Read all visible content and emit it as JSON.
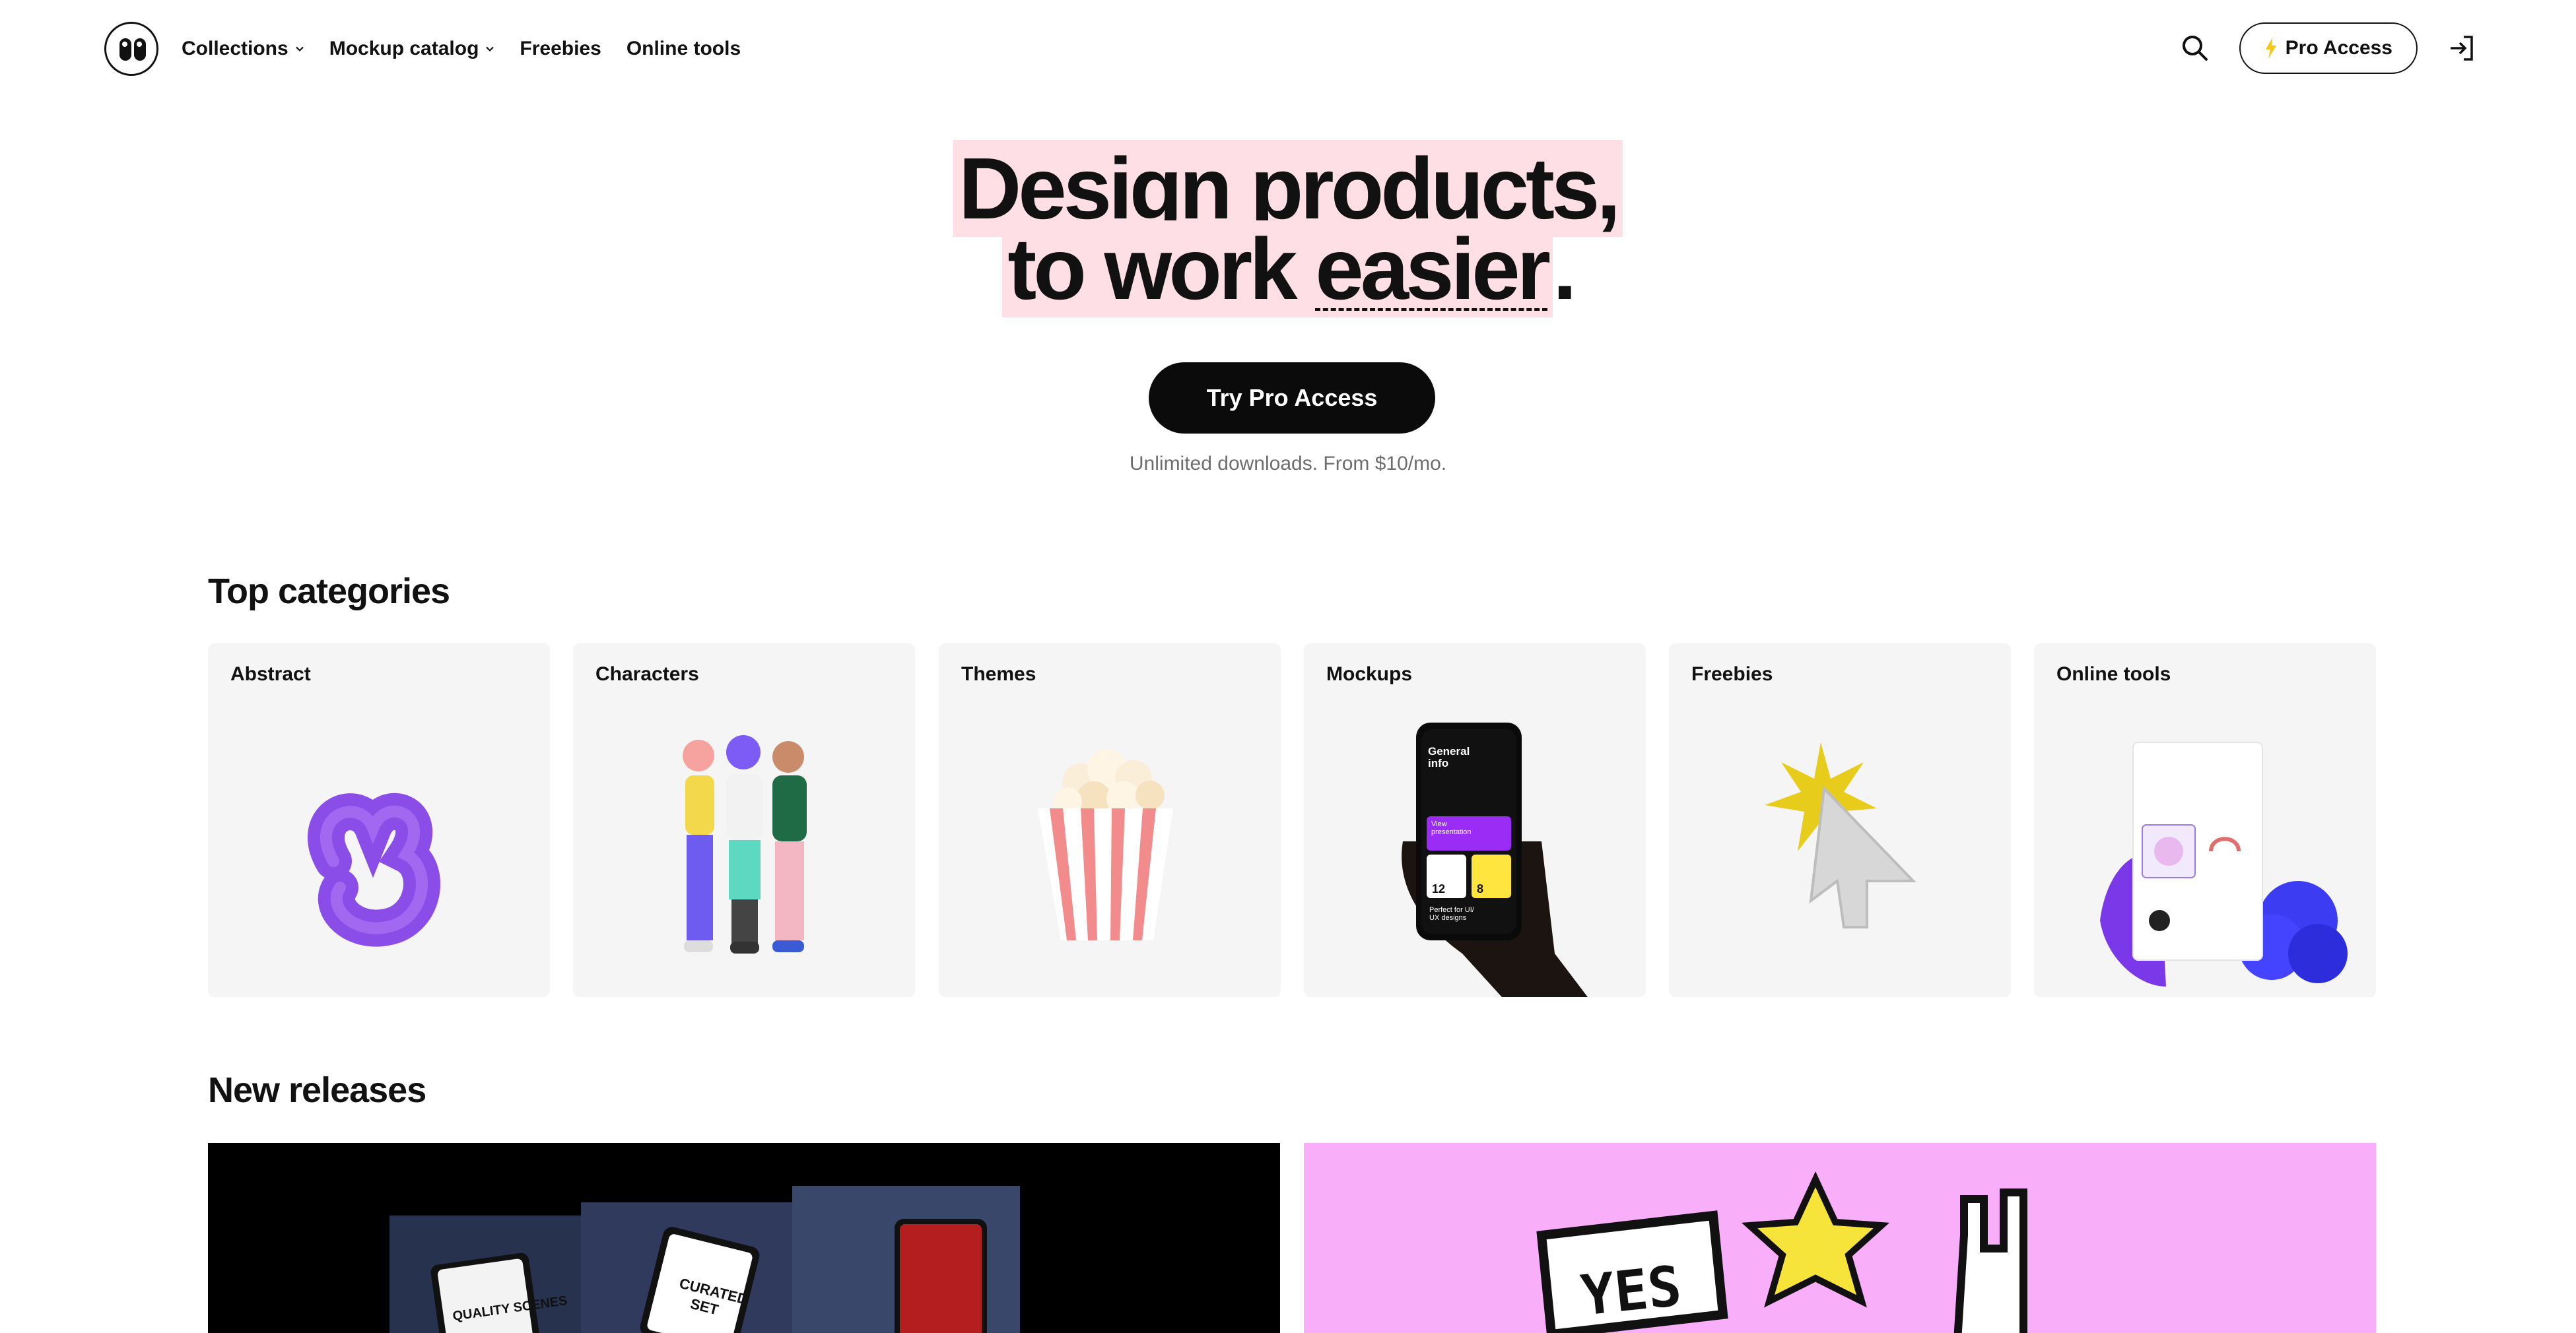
{
  "nav": {
    "items": [
      {
        "label": "Collections",
        "dropdown": true
      },
      {
        "label": "Mockup catalog",
        "dropdown": true
      },
      {
        "label": "Freebies",
        "dropdown": false
      },
      {
        "label": "Online tools",
        "dropdown": false
      }
    ],
    "pro_label": "Pro Access"
  },
  "hero": {
    "line1": "Design products,",
    "line2a": "to work ",
    "line2b": "easier",
    "line2c": ".",
    "cta_label": "Try Pro Access",
    "subtitle": "Unlimited downloads. From $10/mo."
  },
  "top_categories": {
    "title": "Top categories",
    "items": [
      {
        "label": "Abstract"
      },
      {
        "label": "Characters"
      },
      {
        "label": "Themes"
      },
      {
        "label": "Mockups",
        "phone": {
          "line1": "General",
          "line2": "info",
          "card": "View presentation",
          "n1": "12",
          "n2": "8",
          "foot1": "Perfect for UI/",
          "foot2": "UX designs"
        }
      },
      {
        "label": "Freebies"
      },
      {
        "label": "Online tools"
      }
    ]
  },
  "new_releases": {
    "title": "New releases",
    "items": [
      {
        "texts": [
          "QUALITY SCENES",
          "CURATED SET"
        ]
      },
      {
        "texts": [
          "YES"
        ]
      }
    ]
  },
  "colors": {
    "accent_highlight": "#ffdfe6",
    "cta_bg": "#0b0b0b",
    "release_pink": "#f9aef9",
    "abstract_purple": "#8b4de8"
  }
}
